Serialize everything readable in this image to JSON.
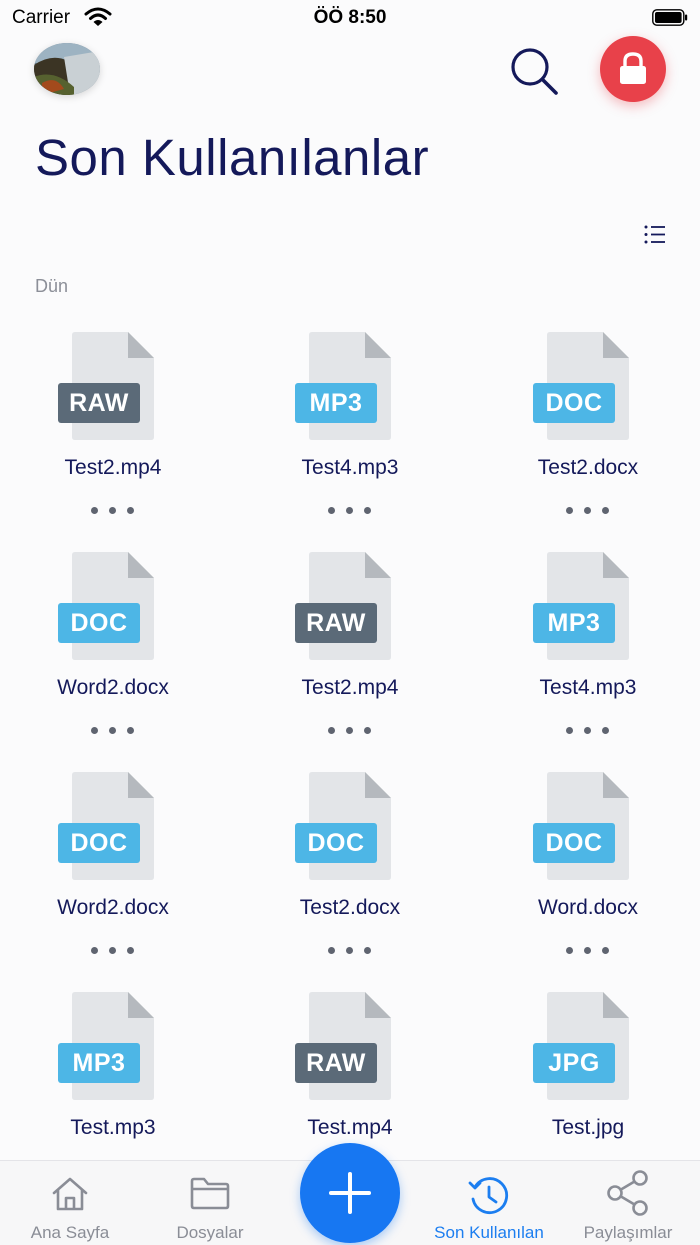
{
  "status_bar": {
    "carrier": "Carrier",
    "time": "ÖÖ 8:50"
  },
  "header": {
    "title": "Son Kullanılanlar"
  },
  "section": {
    "label": "Dün"
  },
  "colors": {
    "doc": "#4db6e6",
    "mp3": "#4db6e6",
    "jpg": "#4db6e6",
    "raw": "#5b6a78",
    "accent": "#1777f2",
    "lock": "#e8414a"
  },
  "files": [
    {
      "type": "RAW",
      "name": "Test2.mp4"
    },
    {
      "type": "MP3",
      "name": "Test4.mp3"
    },
    {
      "type": "DOC",
      "name": "Test2.docx"
    },
    {
      "type": "DOC",
      "name": "Word2.docx"
    },
    {
      "type": "RAW",
      "name": "Test2.mp4"
    },
    {
      "type": "MP3",
      "name": "Test4.mp3"
    },
    {
      "type": "DOC",
      "name": "Word2.docx"
    },
    {
      "type": "DOC",
      "name": "Test2.docx"
    },
    {
      "type": "DOC",
      "name": "Word.docx"
    },
    {
      "type": "MP3",
      "name": "Test.mp3"
    },
    {
      "type": "RAW",
      "name": "Test.mp4"
    },
    {
      "type": "JPG",
      "name": "Test.jpg"
    }
  ],
  "tabbar": {
    "tabs": [
      {
        "label": "Ana Sayfa",
        "icon": "home-icon"
      },
      {
        "label": "Dosyalar",
        "icon": "folder-icon"
      },
      {
        "label": "Son Kullanılan",
        "icon": "history-icon",
        "active": true
      },
      {
        "label": "Paylaşımlar",
        "icon": "share-icon"
      }
    ]
  }
}
